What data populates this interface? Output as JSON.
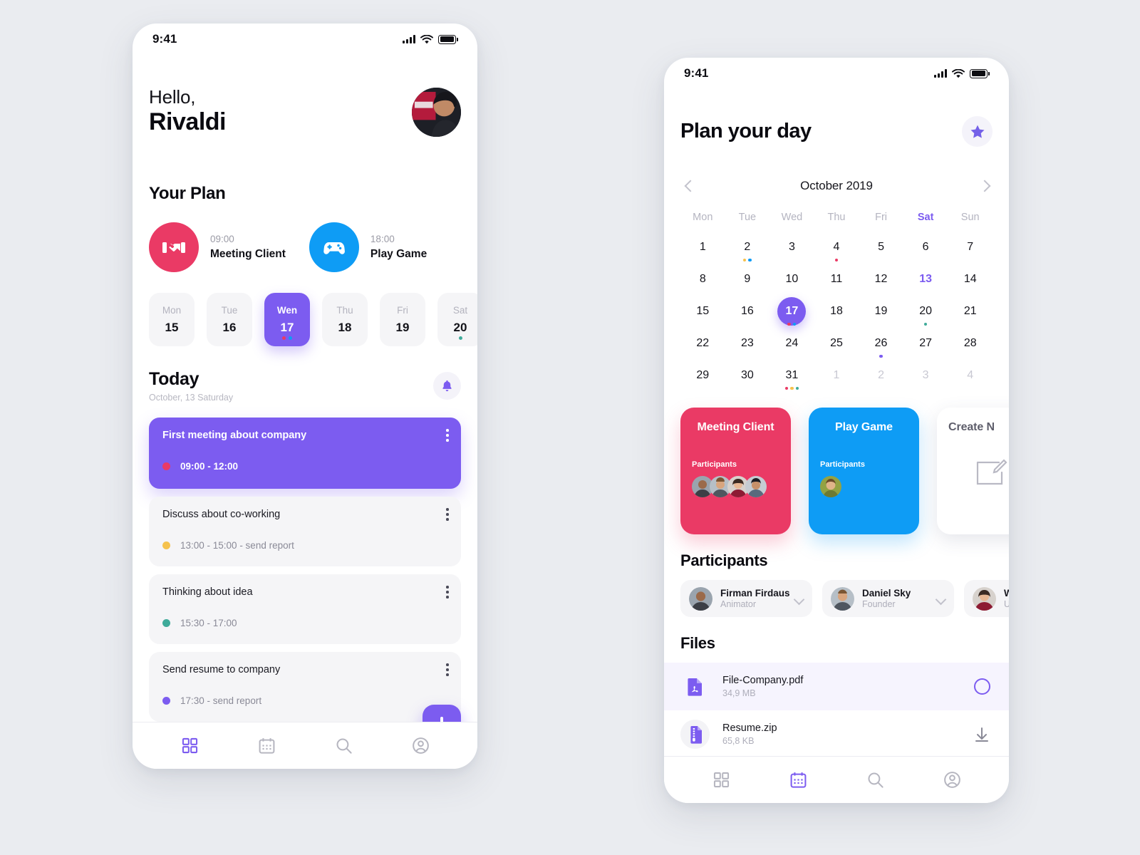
{
  "theme": {
    "background": "#eaecf0",
    "accent": "#7c5cf0",
    "red": "#ea3a65",
    "blue": "#0e9cf5",
    "teal": "#3fab9a",
    "yellow": "#f5c24d"
  },
  "phone1": {
    "status": {
      "time": "9:41",
      "signal_icon": "signal-bars-icon",
      "wifi_icon": "wifi-icon",
      "battery_icon": "battery-icon"
    },
    "greeting": {
      "line1": "Hello,",
      "line2": "Rivaldi",
      "avatar_name": "user-avatar"
    },
    "your_plan": {
      "title": "Your Plan",
      "items": [
        {
          "time": "09:00",
          "name": "Meeting Client",
          "icon": "handshake-icon",
          "color": "#ea3a65"
        },
        {
          "time": "18:00",
          "name": "Play Game",
          "icon": "gamepad-icon",
          "color": "#0e9cf5"
        }
      ]
    },
    "days": [
      {
        "label": "Mon",
        "num": "15",
        "active": false,
        "dots": []
      },
      {
        "label": "Tue",
        "num": "16",
        "active": false,
        "dots": []
      },
      {
        "label": "Wen",
        "num": "17",
        "active": true,
        "dots": [
          "#ea3a65",
          "#0e9cf5"
        ]
      },
      {
        "label": "Thu",
        "num": "18",
        "active": false,
        "dots": []
      },
      {
        "label": "Fri",
        "num": "19",
        "active": false,
        "dots": []
      },
      {
        "label": "Sat",
        "num": "20",
        "active": false,
        "dots": [
          "#3fab9a"
        ]
      }
    ],
    "today": {
      "title": "Today",
      "subtitle": "October, 13 Saturday",
      "bell_icon": "bell-icon"
    },
    "tasks": [
      {
        "title": "First meeting about company",
        "time": "09:00 - 12:00",
        "dot": "#ea3a65",
        "highlighted": true
      },
      {
        "title": "Discuss about co-working",
        "time": "13:00 - 15:00 - send report",
        "dot": "#f5c24d",
        "highlighted": false
      },
      {
        "title": "Thinking about idea",
        "time": "15:30 - 17:00",
        "dot": "#3fab9a",
        "highlighted": false
      },
      {
        "title": "Send resume to company",
        "time": "17:30 - send report",
        "dot": "#7c5cf0",
        "highlighted": false
      }
    ],
    "add_button": "add-task-button",
    "tabs": [
      {
        "icon": "grid-icon",
        "active": true
      },
      {
        "icon": "calendar-icon",
        "active": false
      },
      {
        "icon": "search-icon",
        "active": false
      },
      {
        "icon": "profile-icon",
        "active": false
      }
    ]
  },
  "phone2": {
    "status": {
      "time": "9:41",
      "signal_icon": "signal-bars-icon",
      "wifi_icon": "wifi-icon",
      "battery_icon": "battery-icon"
    },
    "header": {
      "title": "Plan your day",
      "star_icon": "star-icon"
    },
    "calendar": {
      "month": "October 2019",
      "prev_icon": "chevron-left-icon",
      "next_icon": "chevron-right-icon",
      "dow": [
        "Mon",
        "Tue",
        "Wed",
        "Thu",
        "Fri",
        "Sat",
        "Sun"
      ],
      "highlight_dow": "Sat",
      "weeks": [
        [
          {
            "num": "1",
            "state": "normal",
            "dots": []
          },
          {
            "num": "2",
            "state": "normal",
            "dots": [
              "#f5c24d",
              "#0e9cf5"
            ]
          },
          {
            "num": "3",
            "state": "normal",
            "dots": []
          },
          {
            "num": "4",
            "state": "normal",
            "dots": [
              "#ea3a65"
            ]
          },
          {
            "num": "5",
            "state": "normal",
            "dots": []
          },
          {
            "num": "6",
            "state": "normal",
            "dots": []
          },
          {
            "num": "7",
            "state": "normal",
            "dots": []
          }
        ],
        [
          {
            "num": "8",
            "state": "normal",
            "dots": []
          },
          {
            "num": "9",
            "state": "normal",
            "dots": []
          },
          {
            "num": "10",
            "state": "normal",
            "dots": []
          },
          {
            "num": "11",
            "state": "normal",
            "dots": []
          },
          {
            "num": "12",
            "state": "normal",
            "dots": []
          },
          {
            "num": "13",
            "state": "accent",
            "dots": []
          },
          {
            "num": "14",
            "state": "normal",
            "dots": []
          }
        ],
        [
          {
            "num": "15",
            "state": "normal",
            "dots": []
          },
          {
            "num": "16",
            "state": "normal",
            "dots": []
          },
          {
            "num": "17",
            "state": "selected",
            "dots": [
              "#ea3a65",
              "#0e9cf5"
            ]
          },
          {
            "num": "18",
            "state": "normal",
            "dots": []
          },
          {
            "num": "19",
            "state": "normal",
            "dots": []
          },
          {
            "num": "20",
            "state": "normal",
            "dots": [
              "#3fab9a"
            ]
          },
          {
            "num": "21",
            "state": "normal",
            "dots": []
          }
        ],
        [
          {
            "num": "22",
            "state": "normal",
            "dots": []
          },
          {
            "num": "23",
            "state": "normal",
            "dots": []
          },
          {
            "num": "24",
            "state": "normal",
            "dots": []
          },
          {
            "num": "25",
            "state": "normal",
            "dots": []
          },
          {
            "num": "26",
            "state": "normal",
            "dots": [
              "#7c5cf0"
            ]
          },
          {
            "num": "27",
            "state": "normal",
            "dots": []
          },
          {
            "num": "28",
            "state": "normal",
            "dots": []
          }
        ],
        [
          {
            "num": "29",
            "state": "normal",
            "dots": []
          },
          {
            "num": "30",
            "state": "normal",
            "dots": []
          },
          {
            "num": "31",
            "state": "normal",
            "dots": [
              "#ea3a65",
              "#f5c24d",
              "#3fab9a"
            ]
          },
          {
            "num": "1",
            "state": "muted",
            "dots": []
          },
          {
            "num": "2",
            "state": "muted",
            "dots": []
          },
          {
            "num": "3",
            "state": "muted",
            "dots": []
          },
          {
            "num": "4",
            "state": "muted",
            "dots": []
          }
        ]
      ]
    },
    "event_cards": [
      {
        "title": "Meeting Client",
        "participants_label": "Participants",
        "avatars": 4,
        "style": "red"
      },
      {
        "title": "Play Game",
        "participants_label": "Participants",
        "avatars": 1,
        "style": "blue"
      },
      {
        "title": "Create N",
        "style": "white",
        "icon": "edit-note-icon"
      }
    ],
    "participants": {
      "title": "Participants",
      "items": [
        {
          "name": "Firman Firdaus",
          "role": "Animator",
          "chevron": "chevron-down-icon"
        },
        {
          "name": "Daniel Sky",
          "role": "Founder",
          "chevron": "chevron-down-icon"
        },
        {
          "name": "Wen",
          "role": "UX W",
          "chevron": "chevron-down-icon"
        }
      ]
    },
    "files": {
      "title": "Files",
      "items": [
        {
          "name": "File-Company.pdf",
          "size": "34,9 MB",
          "icon": "pdf-file-icon",
          "action": "loading-ring-icon",
          "selected": true
        },
        {
          "name": "Resume.zip",
          "size": "65,8 KB",
          "icon": "zip-file-icon",
          "action": "download-icon",
          "selected": false
        }
      ]
    },
    "tabs": [
      {
        "icon": "grid-icon",
        "active": false
      },
      {
        "icon": "calendar-icon",
        "active": true
      },
      {
        "icon": "search-icon",
        "active": false
      },
      {
        "icon": "profile-icon",
        "active": false
      }
    ]
  }
}
